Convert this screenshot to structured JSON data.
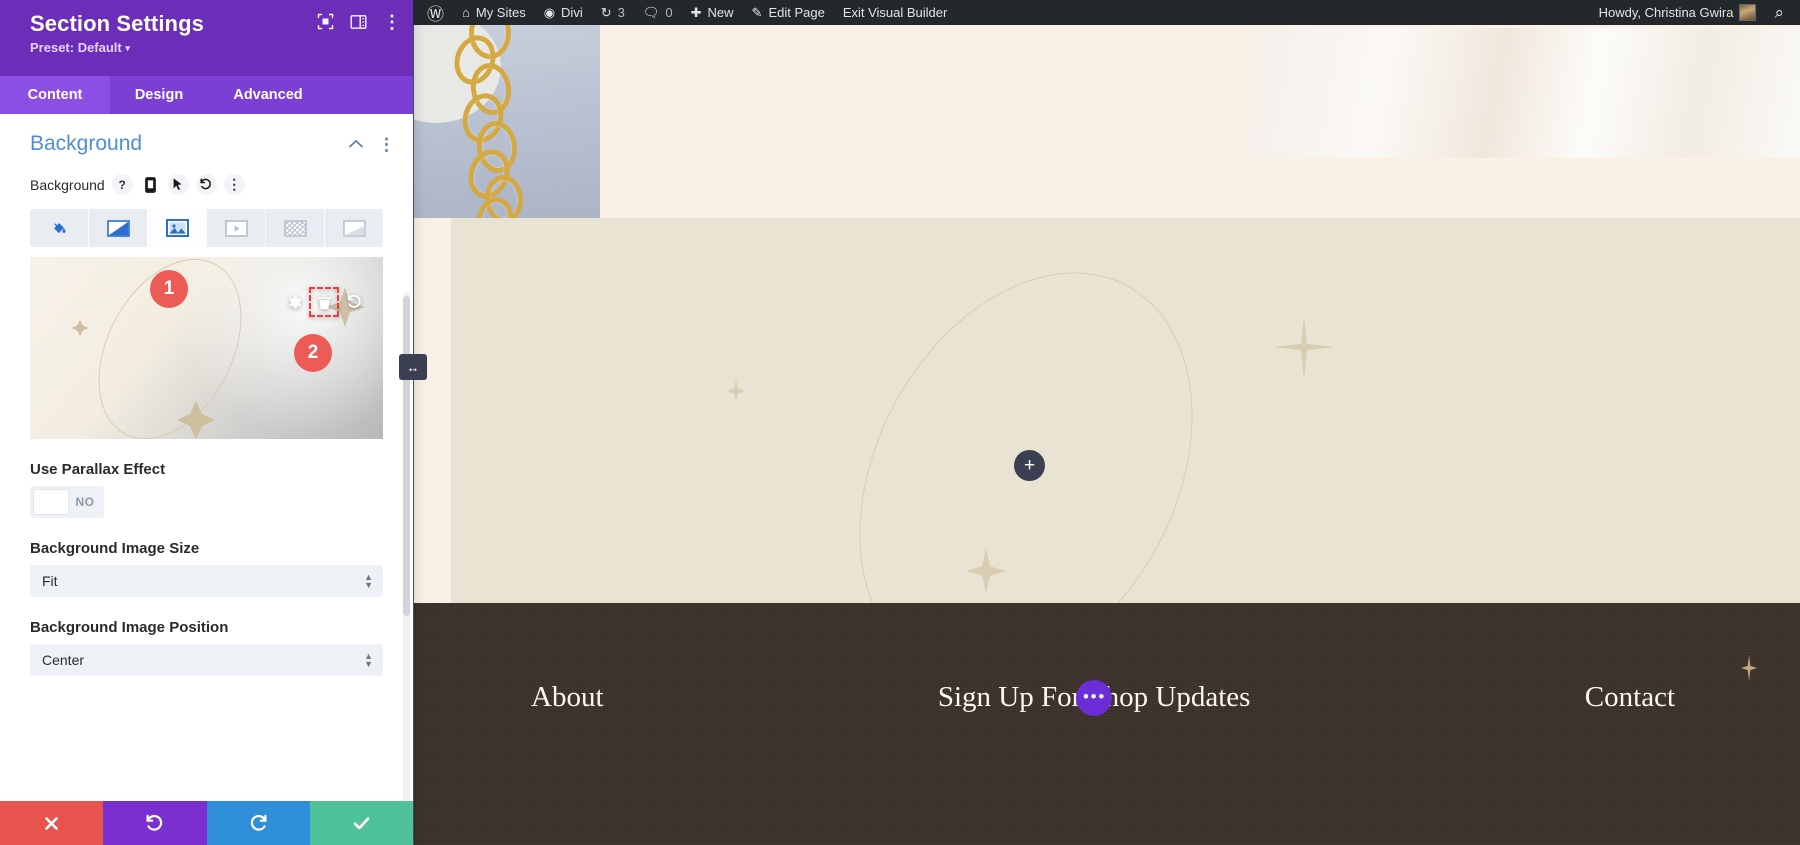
{
  "panel": {
    "title": "Section Settings",
    "preset_label": "Preset: Default",
    "preset_caret": "▾",
    "header_icons": [
      {
        "name": "focus-expand-icon",
        "glyph": "⛶"
      },
      {
        "name": "layout-toggle-icon",
        "glyph": "▥"
      },
      {
        "name": "more-options-icon",
        "glyph": "⋮"
      }
    ],
    "tabs": [
      {
        "label": "Content",
        "active": true
      },
      {
        "label": "Design",
        "active": false
      },
      {
        "label": "Advanced",
        "active": false
      }
    ],
    "accordion": {
      "title": "Background",
      "collapse_icon": "⌃",
      "more_icon": "⋮"
    },
    "background_field": {
      "label": "Background",
      "tools": [
        {
          "name": "help-icon",
          "glyph": "?"
        },
        {
          "name": "responsive-phone-icon",
          "glyph": "▯"
        },
        {
          "name": "hover-cursor-icon",
          "glyph": "➤"
        },
        {
          "name": "reset-undo-icon",
          "glyph": "↺"
        },
        {
          "name": "field-options-icon",
          "glyph": "⋮"
        }
      ]
    },
    "background_types": [
      {
        "name": "background-color-tab",
        "label": "Color",
        "active": false
      },
      {
        "name": "background-gradient-tab",
        "label": "Gradient",
        "active": false
      },
      {
        "name": "background-image-tab",
        "label": "Image",
        "active": true
      },
      {
        "name": "background-video-tab",
        "label": "Video",
        "active": false
      },
      {
        "name": "background-pattern-tab",
        "label": "Pattern",
        "active": false
      },
      {
        "name": "background-mask-tab",
        "label": "Mask",
        "active": false
      }
    ],
    "preview_tools": [
      {
        "name": "image-settings-gear-icon",
        "glyph": "⚙",
        "highlighted": false
      },
      {
        "name": "image-delete-trash-icon",
        "glyph": "🗑",
        "highlighted": true
      },
      {
        "name": "image-reset-undo-icon",
        "glyph": "↺",
        "highlighted": false
      }
    ],
    "annotations": [
      {
        "number": "1"
      },
      {
        "number": "2"
      }
    ],
    "options": [
      {
        "label": "Use Parallax Effect",
        "control": "toggle",
        "value": "NO"
      },
      {
        "label": "Background Image Size",
        "control": "select",
        "value": "Fit"
      },
      {
        "label": "Background Image Position",
        "control": "select",
        "value": "Center"
      }
    ],
    "actions": [
      {
        "name": "cancel-button",
        "glyph": "✖",
        "color": "#E8534E"
      },
      {
        "name": "undo-button",
        "glyph": "↺",
        "color": "#7B2FD1"
      },
      {
        "name": "redo-button",
        "glyph": "↻",
        "color": "#2F8FD8"
      },
      {
        "name": "save-button",
        "glyph": "✔",
        "color": "#4FC19B"
      }
    ]
  },
  "adminbar": {
    "items": [
      {
        "name": "wordpress-logo-icon",
        "glyph": "Ⓦ",
        "label": ""
      },
      {
        "name": "my-sites-menu",
        "glyph": "⌂",
        "label": "My Sites"
      },
      {
        "name": "divi-menu",
        "glyph": "◉",
        "label": "Divi"
      },
      {
        "name": "updates-menu",
        "glyph": "↻",
        "label": "3"
      },
      {
        "name": "comments-menu",
        "glyph": "🗨",
        "label": "0"
      },
      {
        "name": "new-content-menu",
        "glyph": "✚",
        "label": "New"
      },
      {
        "name": "edit-page-menu",
        "glyph": "✎",
        "label": "Edit Page"
      },
      {
        "name": "exit-visual-builder",
        "glyph": "",
        "label": "Exit Visual Builder"
      }
    ],
    "howdy": "Howdy, Christina Gwira",
    "search_icon": "⌕"
  },
  "preview": {
    "plus_button": "+",
    "footer_nav": [
      {
        "label": "About"
      },
      {
        "label": "Sign Up For Shop Updates"
      },
      {
        "label": "Contact"
      }
    ],
    "row_dots": "•••"
  },
  "resize_handle": "↔",
  "colors": {
    "panel_header": "#6C2EB9",
    "tab_bar": "#7B3FD4",
    "accordion_title": "#4C8FD9",
    "badge": "#ED5B57",
    "footer_bg": "#3B302A",
    "mid_bg": "#E8E3D2",
    "hero_bg": "#FAF0E6"
  }
}
